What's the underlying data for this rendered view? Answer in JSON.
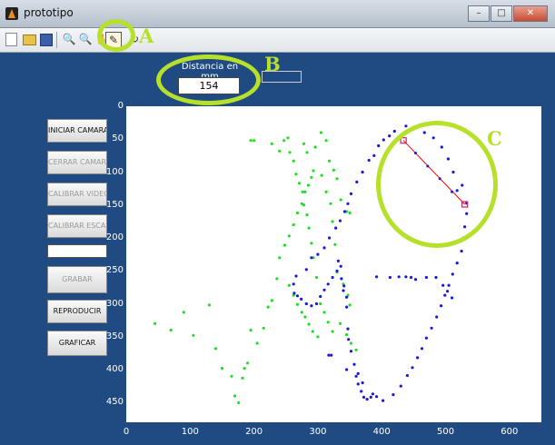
{
  "window": {
    "title": "prototipo"
  },
  "toolbar": {
    "items": [
      "new-file-icon",
      "open-folder-icon",
      "save-icon",
      "zoom-in-icon",
      "zoom-out-icon",
      "pan-icon",
      "data-cursor-icon",
      "rotate-icon"
    ]
  },
  "annotations": {
    "a": "A",
    "b": "B",
    "c": "C",
    "accent": "#b6e02a"
  },
  "distance": {
    "label": "Distancia en mm",
    "value": "154"
  },
  "buttons": {
    "iniciar_camara": "INICIAR CAMARA",
    "cerrar_camara": "CERRAR CAMARA",
    "calibrar_video": "CALIBRAR VIDEO",
    "calibrar_escala": "CALIBRAR ESCALA",
    "grabar": "GRABAR",
    "reproducir": "REPRODUCIR",
    "graficar": "GRAFICAR"
  },
  "chart_data": {
    "type": "scatter",
    "xlim": [
      0,
      650
    ],
    "ylim": [
      480,
      0
    ],
    "x_ticks": [
      "0",
      "100",
      "200",
      "300",
      "400",
      "500",
      "600"
    ],
    "y_ticks": [
      "0",
      "50",
      "100",
      "150",
      "200",
      "250",
      "300",
      "350",
      "400",
      "450"
    ],
    "colors": {
      "green_series": "#22dd22",
      "blue_series": "#1a1adc",
      "measure_line": "#ff0000"
    },
    "series": [
      {
        "color": "#22dd22",
        "points": [
          [
            45,
            330
          ],
          [
            70,
            340
          ],
          [
            90,
            313
          ],
          [
            105,
            348
          ],
          [
            130,
            302
          ],
          [
            140,
            368
          ],
          [
            150,
            398
          ],
          [
            165,
            410
          ],
          [
            170,
            440
          ],
          [
            176,
            450
          ],
          [
            182,
            413
          ],
          [
            185,
            398
          ],
          [
            190,
            390
          ],
          [
            195,
            340
          ],
          [
            205,
            360
          ],
          [
            215,
            337
          ],
          [
            222,
            305
          ],
          [
            228,
            295
          ],
          [
            236,
            262
          ],
          [
            240,
            230
          ],
          [
            248,
            211
          ],
          [
            255,
            197
          ],
          [
            262,
            180
          ],
          [
            268,
            162
          ],
          [
            275,
            148
          ],
          [
            280,
            130
          ],
          [
            285,
            120
          ],
          [
            290,
            108
          ],
          [
            293,
            98
          ],
          [
            278,
            57
          ],
          [
            283,
            70
          ],
          [
            296,
            62
          ],
          [
            306,
            105
          ],
          [
            313,
            130
          ],
          [
            320,
            148
          ],
          [
            323,
            175
          ],
          [
            327,
            210
          ],
          [
            330,
            252
          ],
          [
            340,
            270
          ],
          [
            347,
            287
          ],
          [
            350,
            302
          ],
          [
            195,
            52
          ],
          [
            200,
            52
          ],
          [
            228,
            57
          ],
          [
            240,
            68
          ],
          [
            247,
            52
          ],
          [
            253,
            48
          ],
          [
            256,
            70
          ],
          [
            262,
            83
          ],
          [
            266,
            103
          ],
          [
            271,
            117
          ],
          [
            276,
            130
          ],
          [
            278,
            150
          ],
          [
            283,
            165
          ],
          [
            286,
            185
          ],
          [
            290,
            208
          ],
          [
            293,
            230
          ],
          [
            298,
            260
          ],
          [
            304,
            300
          ],
          [
            310,
            313
          ],
          [
            316,
            328
          ],
          [
            323,
            342
          ],
          [
            255,
            272
          ],
          [
            262,
            287
          ],
          [
            268,
            301
          ],
          [
            275,
            313
          ],
          [
            280,
            320
          ],
          [
            286,
            331
          ],
          [
            292,
            342
          ],
          [
            300,
            350
          ],
          [
            305,
            40
          ],
          [
            313,
            52
          ],
          [
            318,
            83
          ],
          [
            325,
            97
          ],
          [
            330,
            110
          ],
          [
            336,
            142
          ],
          [
            345,
            160
          ],
          [
            350,
            162
          ],
          [
            335,
            330
          ],
          [
            345,
            347
          ],
          [
            352,
            360
          ],
          [
            360,
            370
          ]
        ]
      },
      {
        "color": "#1a1adc",
        "points": [
          [
            336,
            243
          ],
          [
            337,
            262
          ],
          [
            341,
            273
          ],
          [
            345,
            290
          ],
          [
            345,
            305
          ],
          [
            347,
            338
          ],
          [
            348,
            354
          ],
          [
            352,
            372
          ],
          [
            357,
            392
          ],
          [
            360,
            410
          ],
          [
            363,
            422
          ],
          [
            368,
            433
          ],
          [
            372,
            442
          ],
          [
            377,
            445
          ],
          [
            383,
            442
          ],
          [
            386,
            437
          ],
          [
            392,
            441
          ],
          [
            402,
            447
          ],
          [
            418,
            438
          ],
          [
            430,
            425
          ],
          [
            440,
            409
          ],
          [
            448,
            397
          ],
          [
            456,
            382
          ],
          [
            463,
            368
          ],
          [
            470,
            352
          ],
          [
            478,
            337
          ],
          [
            486,
            320
          ],
          [
            493,
            303
          ],
          [
            499,
            287
          ],
          [
            505,
            272
          ],
          [
            511,
            255
          ],
          [
            518,
            238
          ],
          [
            525,
            220
          ],
          [
            528,
            200
          ],
          [
            530,
            183
          ],
          [
            533,
            163
          ],
          [
            533,
            147
          ],
          [
            518,
            128
          ],
          [
            526,
            120
          ],
          [
            512,
            100
          ],
          [
            504,
            80
          ],
          [
            494,
            62
          ],
          [
            481,
            48
          ],
          [
            467,
            40
          ],
          [
            450,
            32
          ],
          [
            438,
            30
          ],
          [
            420,
            38
          ],
          [
            412,
            45
          ],
          [
            403,
            51
          ],
          [
            395,
            60
          ],
          [
            388,
            75
          ],
          [
            380,
            82
          ],
          [
            370,
            100
          ],
          [
            361,
            115
          ],
          [
            352,
            133
          ],
          [
            347,
            148
          ],
          [
            342,
            160
          ],
          [
            335,
            174
          ],
          [
            328,
            185
          ],
          [
            318,
            200
          ],
          [
            310,
            215
          ],
          [
            300,
            225
          ],
          [
            290,
            230
          ],
          [
            282,
            248
          ],
          [
            266,
            258
          ],
          [
            262,
            270
          ],
          [
            263,
            284
          ],
          [
            268,
            288
          ],
          [
            274,
            293
          ],
          [
            282,
            300
          ],
          [
            290,
            303
          ],
          [
            298,
            300
          ],
          [
            304,
            289
          ],
          [
            310,
            279
          ],
          [
            316,
            270
          ],
          [
            323,
            260
          ],
          [
            330,
            250
          ],
          [
            332,
            235
          ],
          [
            340,
            280
          ],
          [
            392,
            259
          ],
          [
            413,
            260
          ],
          [
            427,
            259
          ],
          [
            438,
            259
          ],
          [
            446,
            260
          ],
          [
            453,
            263
          ],
          [
            470,
            260
          ],
          [
            485,
            260
          ],
          [
            496,
            272
          ],
          [
            503,
            281
          ],
          [
            510,
            291
          ],
          [
            317,
            378
          ],
          [
            321,
            378
          ],
          [
            345,
            400
          ],
          [
            363,
            406
          ],
          [
            370,
            420
          ]
        ]
      }
    ],
    "measure_line": {
      "start": [
        434,
        52
      ],
      "end": [
        530,
        149
      ],
      "intermediate": [
        [
          453,
          71
        ],
        [
          472,
          91
        ],
        [
          491,
          110
        ],
        [
          510,
          130
        ]
      ]
    }
  }
}
